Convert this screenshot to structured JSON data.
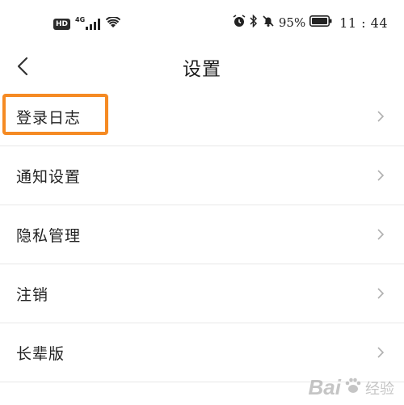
{
  "status_bar": {
    "hd_badge": "HD",
    "network": "4G",
    "battery_percent": "95%",
    "time": "11 : 44"
  },
  "header": {
    "title": "设置"
  },
  "menu": {
    "items": [
      {
        "label": "登录日志"
      },
      {
        "label": "通知设置"
      },
      {
        "label": "隐私管理"
      },
      {
        "label": "注销"
      },
      {
        "label": "长辈版"
      }
    ]
  },
  "watermark": {
    "brand": "Bai",
    "sub": "经验"
  },
  "colors": {
    "highlight": "#f58a23",
    "divider": "#e8e8e8",
    "chevron": "#b0b0b0"
  }
}
